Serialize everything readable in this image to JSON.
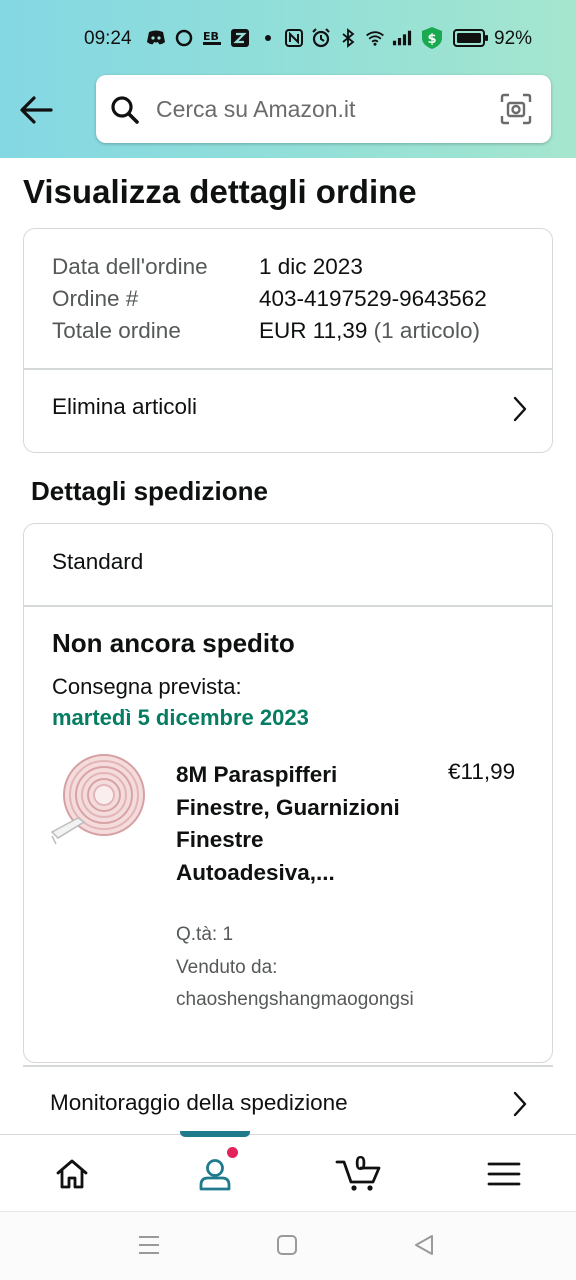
{
  "status_bar": {
    "time": "09:24",
    "battery": "92%",
    "icons": [
      "discord-icon",
      "circle-app-icon",
      "eb-app-icon",
      "z-app-icon",
      "dot-icon",
      "nfc-icon",
      "alarm-icon",
      "bluetooth-icon",
      "wifi-icon",
      "signal-icon",
      "vpn-shield-icon",
      "battery-icon"
    ]
  },
  "search": {
    "placeholder": "Cerca su Amazon.it"
  },
  "page": {
    "title": "Visualizza dettagli ordine"
  },
  "order": {
    "date_label": "Data dell'ordine",
    "date_value": "1 dic 2023",
    "number_label": "Ordine #",
    "number_value": "403-4197529-9643562",
    "total_label": "Totale ordine",
    "total_value": "EUR 11,39",
    "total_items": "(1 articolo)",
    "remove_items_label": "Elimina articoli"
  },
  "shipment": {
    "section_title": "Dettagli spedizione",
    "method": "Standard",
    "status": "Non ancora spedito",
    "delivery_label": "Consegna prevista:",
    "delivery_date": "martedì 5 dicembre 2023",
    "product": {
      "title": "8M Paraspifferi Finestre, Guarnizioni Finestre Autoadesiva,...",
      "price": "€11,99",
      "qty": "Q.tà: 1",
      "seller_label": "Venduto da:",
      "seller_name": "chaoshengshangmaogongsi"
    },
    "tracking_label": "Monitoraggio della spedizione"
  },
  "bottom_nav": {
    "items": [
      "home-icon",
      "account-icon",
      "cart-icon",
      "menu-icon"
    ],
    "cart_count": "0",
    "active": "account-icon"
  },
  "colors": {
    "header_start": "#84d8e3",
    "header_end": "#a5e6ce",
    "delivery_green": "#067d62",
    "active_teal": "#1f7a8c",
    "notif_pink": "#e3245b"
  }
}
